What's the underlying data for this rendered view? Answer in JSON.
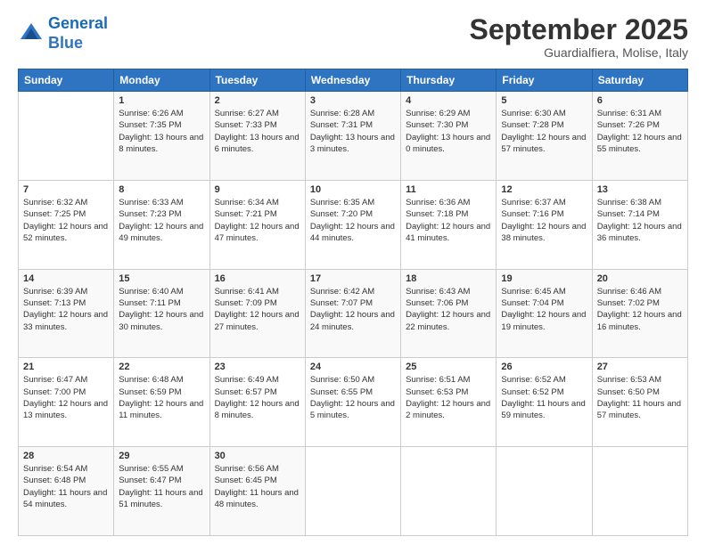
{
  "logo": {
    "line1": "General",
    "line2": "Blue"
  },
  "title": "September 2025",
  "location": "Guardialfiera, Molise, Italy",
  "weekdays": [
    "Sunday",
    "Monday",
    "Tuesday",
    "Wednesday",
    "Thursday",
    "Friday",
    "Saturday"
  ],
  "weeks": [
    [
      {
        "day": "",
        "sunrise": "",
        "sunset": "",
        "daylight": ""
      },
      {
        "day": "1",
        "sunrise": "Sunrise: 6:26 AM",
        "sunset": "Sunset: 7:35 PM",
        "daylight": "Daylight: 13 hours and 8 minutes."
      },
      {
        "day": "2",
        "sunrise": "Sunrise: 6:27 AM",
        "sunset": "Sunset: 7:33 PM",
        "daylight": "Daylight: 13 hours and 6 minutes."
      },
      {
        "day": "3",
        "sunrise": "Sunrise: 6:28 AM",
        "sunset": "Sunset: 7:31 PM",
        "daylight": "Daylight: 13 hours and 3 minutes."
      },
      {
        "day": "4",
        "sunrise": "Sunrise: 6:29 AM",
        "sunset": "Sunset: 7:30 PM",
        "daylight": "Daylight: 13 hours and 0 minutes."
      },
      {
        "day": "5",
        "sunrise": "Sunrise: 6:30 AM",
        "sunset": "Sunset: 7:28 PM",
        "daylight": "Daylight: 12 hours and 57 minutes."
      },
      {
        "day": "6",
        "sunrise": "Sunrise: 6:31 AM",
        "sunset": "Sunset: 7:26 PM",
        "daylight": "Daylight: 12 hours and 55 minutes."
      }
    ],
    [
      {
        "day": "7",
        "sunrise": "Sunrise: 6:32 AM",
        "sunset": "Sunset: 7:25 PM",
        "daylight": "Daylight: 12 hours and 52 minutes."
      },
      {
        "day": "8",
        "sunrise": "Sunrise: 6:33 AM",
        "sunset": "Sunset: 7:23 PM",
        "daylight": "Daylight: 12 hours and 49 minutes."
      },
      {
        "day": "9",
        "sunrise": "Sunrise: 6:34 AM",
        "sunset": "Sunset: 7:21 PM",
        "daylight": "Daylight: 12 hours and 47 minutes."
      },
      {
        "day": "10",
        "sunrise": "Sunrise: 6:35 AM",
        "sunset": "Sunset: 7:20 PM",
        "daylight": "Daylight: 12 hours and 44 minutes."
      },
      {
        "day": "11",
        "sunrise": "Sunrise: 6:36 AM",
        "sunset": "Sunset: 7:18 PM",
        "daylight": "Daylight: 12 hours and 41 minutes."
      },
      {
        "day": "12",
        "sunrise": "Sunrise: 6:37 AM",
        "sunset": "Sunset: 7:16 PM",
        "daylight": "Daylight: 12 hours and 38 minutes."
      },
      {
        "day": "13",
        "sunrise": "Sunrise: 6:38 AM",
        "sunset": "Sunset: 7:14 PM",
        "daylight": "Daylight: 12 hours and 36 minutes."
      }
    ],
    [
      {
        "day": "14",
        "sunrise": "Sunrise: 6:39 AM",
        "sunset": "Sunset: 7:13 PM",
        "daylight": "Daylight: 12 hours and 33 minutes."
      },
      {
        "day": "15",
        "sunrise": "Sunrise: 6:40 AM",
        "sunset": "Sunset: 7:11 PM",
        "daylight": "Daylight: 12 hours and 30 minutes."
      },
      {
        "day": "16",
        "sunrise": "Sunrise: 6:41 AM",
        "sunset": "Sunset: 7:09 PM",
        "daylight": "Daylight: 12 hours and 27 minutes."
      },
      {
        "day": "17",
        "sunrise": "Sunrise: 6:42 AM",
        "sunset": "Sunset: 7:07 PM",
        "daylight": "Daylight: 12 hours and 24 minutes."
      },
      {
        "day": "18",
        "sunrise": "Sunrise: 6:43 AM",
        "sunset": "Sunset: 7:06 PM",
        "daylight": "Daylight: 12 hours and 22 minutes."
      },
      {
        "day": "19",
        "sunrise": "Sunrise: 6:45 AM",
        "sunset": "Sunset: 7:04 PM",
        "daylight": "Daylight: 12 hours and 19 minutes."
      },
      {
        "day": "20",
        "sunrise": "Sunrise: 6:46 AM",
        "sunset": "Sunset: 7:02 PM",
        "daylight": "Daylight: 12 hours and 16 minutes."
      }
    ],
    [
      {
        "day": "21",
        "sunrise": "Sunrise: 6:47 AM",
        "sunset": "Sunset: 7:00 PM",
        "daylight": "Daylight: 12 hours and 13 minutes."
      },
      {
        "day": "22",
        "sunrise": "Sunrise: 6:48 AM",
        "sunset": "Sunset: 6:59 PM",
        "daylight": "Daylight: 12 hours and 11 minutes."
      },
      {
        "day": "23",
        "sunrise": "Sunrise: 6:49 AM",
        "sunset": "Sunset: 6:57 PM",
        "daylight": "Daylight: 12 hours and 8 minutes."
      },
      {
        "day": "24",
        "sunrise": "Sunrise: 6:50 AM",
        "sunset": "Sunset: 6:55 PM",
        "daylight": "Daylight: 12 hours and 5 minutes."
      },
      {
        "day": "25",
        "sunrise": "Sunrise: 6:51 AM",
        "sunset": "Sunset: 6:53 PM",
        "daylight": "Daylight: 12 hours and 2 minutes."
      },
      {
        "day": "26",
        "sunrise": "Sunrise: 6:52 AM",
        "sunset": "Sunset: 6:52 PM",
        "daylight": "Daylight: 11 hours and 59 minutes."
      },
      {
        "day": "27",
        "sunrise": "Sunrise: 6:53 AM",
        "sunset": "Sunset: 6:50 PM",
        "daylight": "Daylight: 11 hours and 57 minutes."
      }
    ],
    [
      {
        "day": "28",
        "sunrise": "Sunrise: 6:54 AM",
        "sunset": "Sunset: 6:48 PM",
        "daylight": "Daylight: 11 hours and 54 minutes."
      },
      {
        "day": "29",
        "sunrise": "Sunrise: 6:55 AM",
        "sunset": "Sunset: 6:47 PM",
        "daylight": "Daylight: 11 hours and 51 minutes."
      },
      {
        "day": "30",
        "sunrise": "Sunrise: 6:56 AM",
        "sunset": "Sunset: 6:45 PM",
        "daylight": "Daylight: 11 hours and 48 minutes."
      },
      {
        "day": "",
        "sunrise": "",
        "sunset": "",
        "daylight": ""
      },
      {
        "day": "",
        "sunrise": "",
        "sunset": "",
        "daylight": ""
      },
      {
        "day": "",
        "sunrise": "",
        "sunset": "",
        "daylight": ""
      },
      {
        "day": "",
        "sunrise": "",
        "sunset": "",
        "daylight": ""
      }
    ]
  ]
}
